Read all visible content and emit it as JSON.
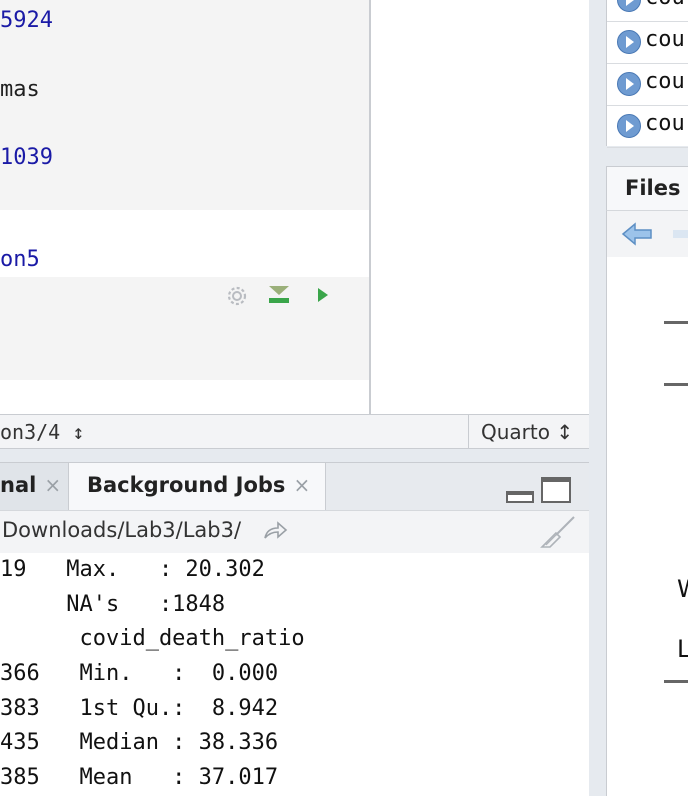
{
  "editor": {
    "lines": [
      {
        "text": "5924",
        "color": "#1a1aa6"
      },
      {
        "text": "mas",
        "color": "#1f1f1f"
      },
      {
        "text": "1039",
        "color": "#1a1aa6"
      },
      {
        "text": "on5",
        "color": "#1a1aa6"
      }
    ]
  },
  "statusbar": {
    "left": "on3/4 ↕",
    "right": "Quarto ↕"
  },
  "console_tabs": {
    "terminal_label": "nal",
    "background_jobs_label": "Background Jobs",
    "close_glyph": "×"
  },
  "console": {
    "path": "Downloads/Lab3/Lab3/",
    "lines": [
      "19   Max.   : 20.302",
      "     NA's   :1848",
      "      covid_death_ratio",
      "366   Min.   :  0.000",
      "383   1st Qu.:  8.942",
      "435   Median : 38.336",
      "385   Mean   : 37.017"
    ]
  },
  "environment": {
    "rows": [
      {
        "label": "cou"
      },
      {
        "label": "cou"
      },
      {
        "label": "cou"
      },
      {
        "label": "cou"
      }
    ]
  },
  "files": {
    "tab_label": "Files",
    "text_w": "W",
    "text_l": "L"
  },
  "colors": {
    "run_green": "#3aa54a",
    "accent_blue": "#6f9bd1"
  }
}
